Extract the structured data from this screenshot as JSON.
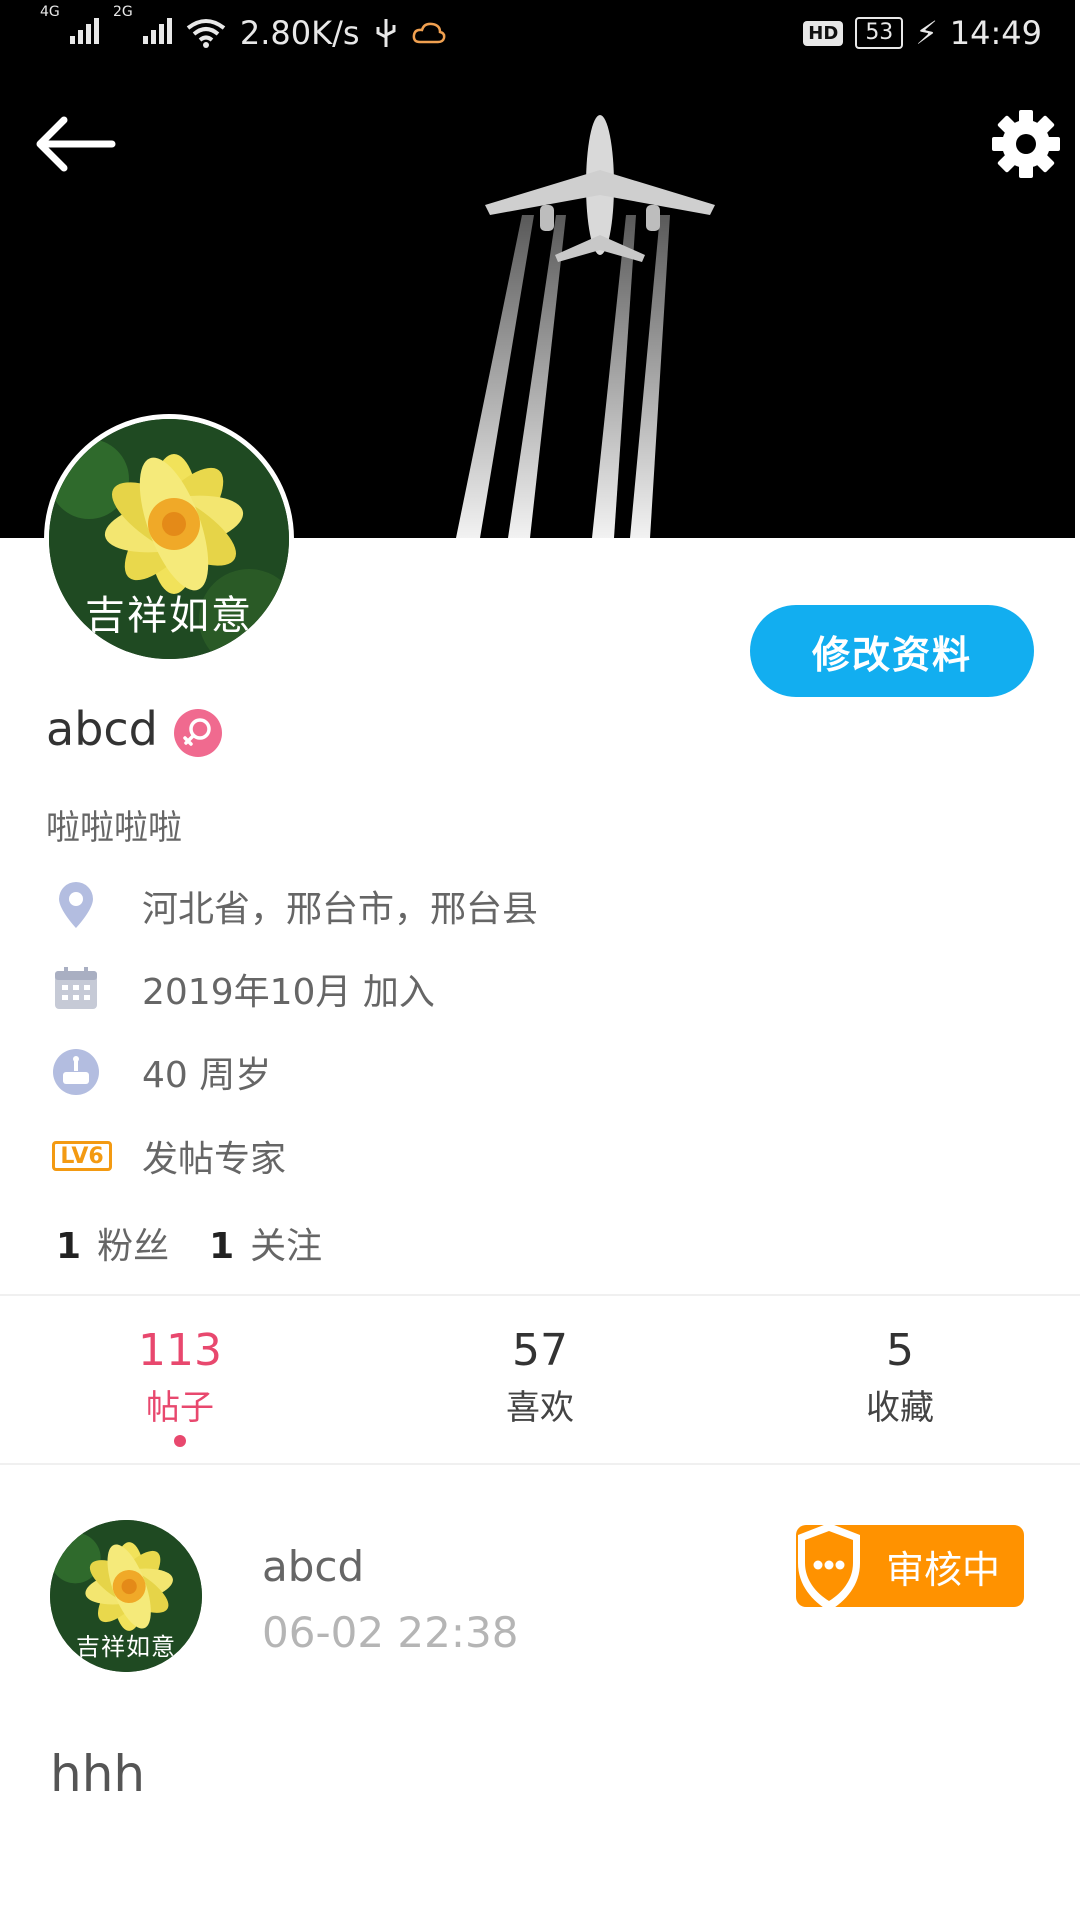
{
  "status_bar": {
    "network_1": "4G",
    "network_2": "2G",
    "speed": "2.80K/s",
    "hd": "HD",
    "battery": "53",
    "time": "14:49"
  },
  "header": {
    "back_icon": "arrow-left-icon",
    "settings_icon": "gear-icon"
  },
  "profile": {
    "avatar_caption": "吉祥如意",
    "username": "abcd",
    "gender_icon": "female-icon",
    "edit_button": "修改资料",
    "bio": "啦啦啦啦",
    "location": "河北省，邢台市，邢台县",
    "joined": "2019年10月 加入",
    "age": "40 周岁",
    "level_badge": "LV6",
    "level_title": "发帖专家",
    "followers_count": "1",
    "followers_label": "粉丝",
    "following_count": "1",
    "following_label": "关注"
  },
  "tabs": [
    {
      "count": "113",
      "label": "帖子",
      "active": true
    },
    {
      "count": "57",
      "label": "喜欢",
      "active": false
    },
    {
      "count": "5",
      "label": "收藏",
      "active": false
    }
  ],
  "post": {
    "author": "abcd",
    "time": "06-02 22:38",
    "status": "审核中",
    "body": "hhh",
    "avatar_caption": "吉祥如意"
  },
  "colors": {
    "accent_blue": "#12aef0",
    "active_pink": "#e8486e",
    "review_orange": "#ff9200",
    "level_orange": "#f39a12"
  }
}
